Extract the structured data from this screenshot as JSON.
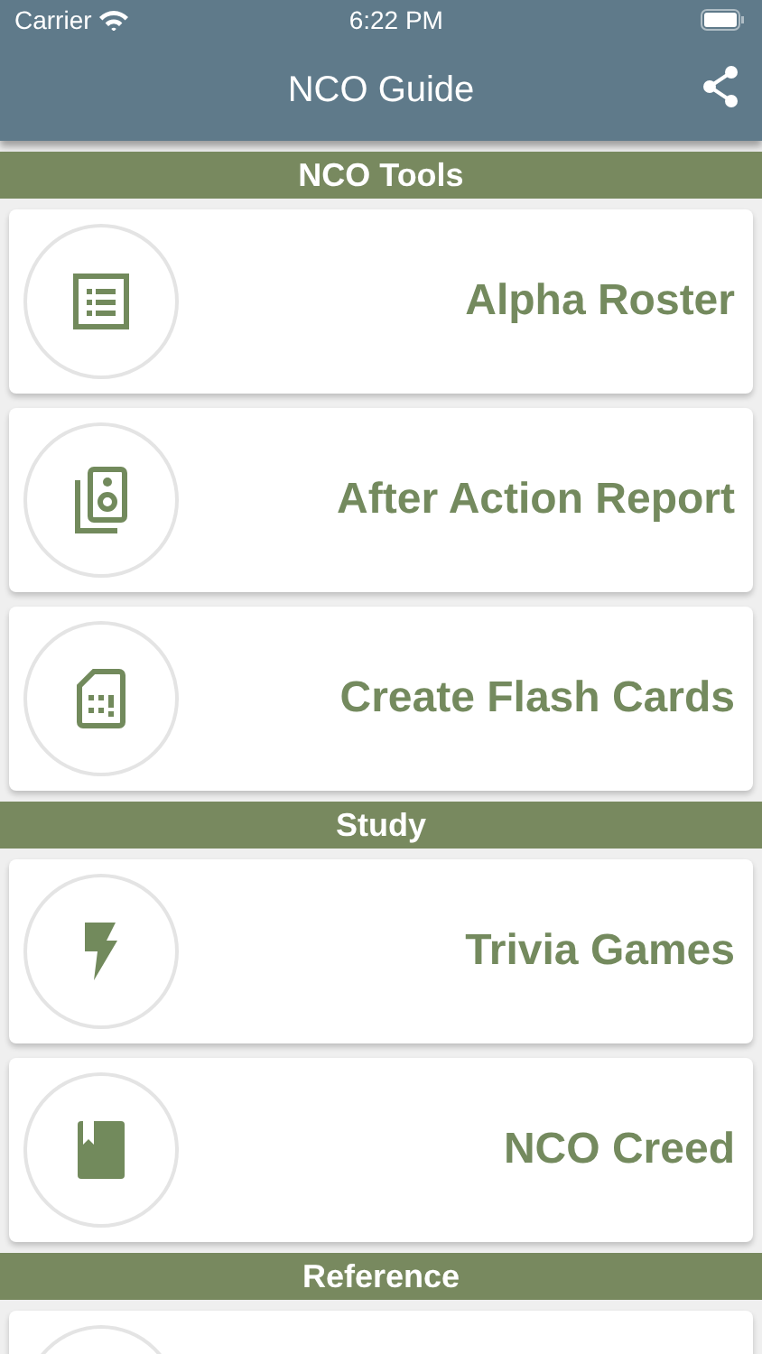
{
  "status_bar": {
    "carrier": "Carrier",
    "time": "6:22 PM"
  },
  "navbar": {
    "title": "NCO Guide"
  },
  "sections": [
    {
      "title": "NCO Tools",
      "items": [
        {
          "kind": "entry",
          "label": "Alpha Roster"
        },
        {
          "kind": "entry",
          "label": "After Action Report"
        },
        {
          "kind": "entry",
          "label": "Create Flash Cards"
        }
      ]
    },
    {
      "title": "Study",
      "items": [
        {
          "kind": "entry",
          "label": "Trivia Games"
        },
        {
          "kind": "entry",
          "label": "NCO Creed"
        }
      ]
    },
    {
      "title": "Reference",
      "items": [
        {
          "kind": "partial"
        }
      ]
    }
  ]
}
